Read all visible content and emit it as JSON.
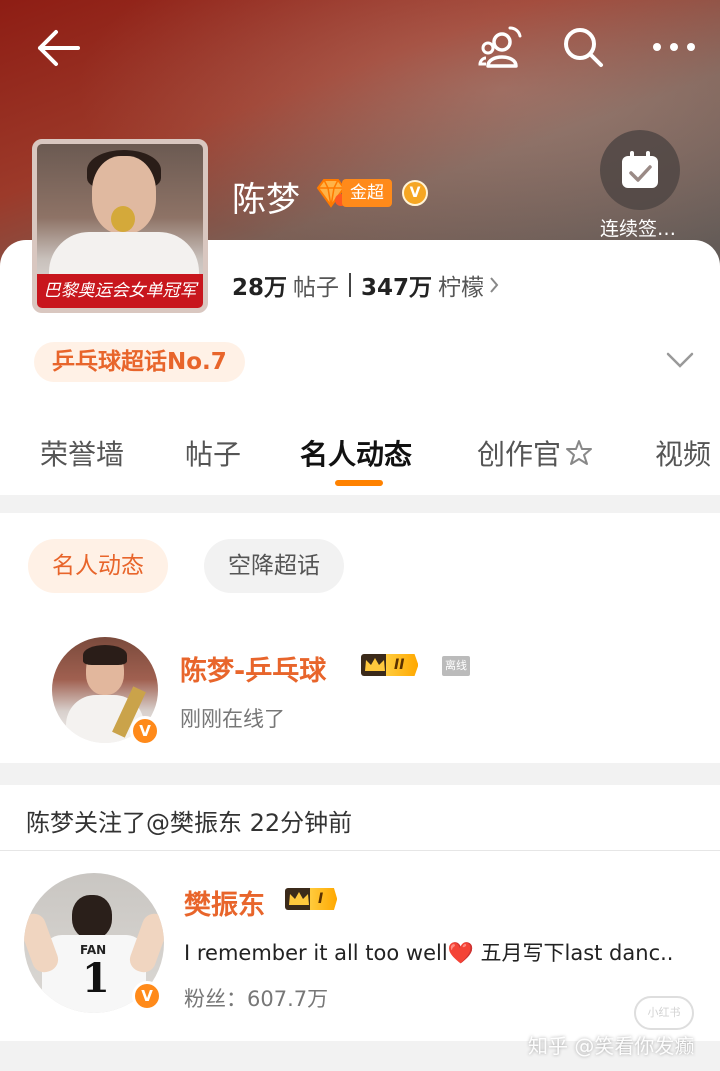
{
  "colors": {
    "accent": "#ff8200",
    "brand_orange": "#e8652b",
    "badge_orange": "#ff8a1a",
    "hero_red": "#8e1d14"
  },
  "topbar": {
    "back_icon": "arrow-left-icon",
    "people_icon": "people-icon",
    "search_icon": "search-icon",
    "more_icon": "more-icon"
  },
  "checkin": {
    "label": "连续签…",
    "icon": "calendar-check-icon"
  },
  "profile": {
    "name": "陈梦",
    "badge_label": "金超",
    "avatar_banner": "巴黎奥运会女单冠军",
    "posts_count": "28万",
    "posts_label": "帖子",
    "lemons_count": "347万",
    "lemons_label": "柠檬",
    "rank_chip": "乒乓球超话No.7"
  },
  "tabs": [
    {
      "label": "荣誉墙"
    },
    {
      "label": "帖子"
    },
    {
      "label": "名人动态",
      "active": true
    },
    {
      "label": "创作官"
    },
    {
      "label": "视频"
    }
  ],
  "filters": {
    "active": "名人动态",
    "idle": "空降超话"
  },
  "user1": {
    "name": "陈梦-乒乓球",
    "level": "II",
    "offline_badge": "离线",
    "status": "刚刚在线了",
    "verified": "V"
  },
  "activity": {
    "text": "陈梦关注了@樊振东 22分钟前"
  },
  "user2": {
    "name": "樊振东",
    "level": "I",
    "bio": "I remember it all too well❤️ 五月写下last danc..",
    "fans": "粉丝：607.7万",
    "jersey_name": "FAN",
    "jersey_number": "1",
    "verified": "V"
  },
  "watermark": {
    "text": "知乎 @笑看你发癫",
    "logo": "小红书"
  }
}
